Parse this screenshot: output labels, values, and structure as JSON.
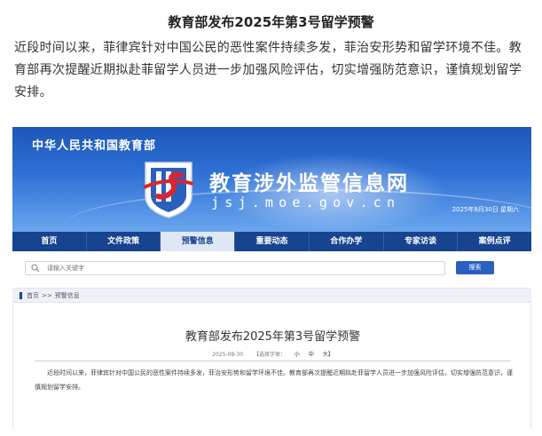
{
  "article": {
    "title": "教育部发布2025年第3号留学预警",
    "lead": "近段时间以来，菲律宾针对中国公民的恶性案件持续多发，菲治安形势和留学环境不佳。教育部再次提醒近期拟赴菲留学人员进一步加强风险评估，切实增强防范意识，谨慎规划留学安排。"
  },
  "site": {
    "ministry": "中华人民共和国教育部",
    "name": "教育涉外监管信息网",
    "domain": "jsj.moe.gov.cn",
    "date": "2025年8月30日 星期六"
  },
  "nav": {
    "items": [
      {
        "label": "首页"
      },
      {
        "label": "文件政策"
      },
      {
        "label": "预警信息"
      },
      {
        "label": "重要动态"
      },
      {
        "label": "合作办学"
      },
      {
        "label": "专家访谈"
      },
      {
        "label": "案例点评"
      }
    ],
    "active_index": 2
  },
  "search": {
    "placeholder": "请输入关键字",
    "button_label": "搜索"
  },
  "breadcrumb": {
    "home": "首页",
    "separator": ">>",
    "current": "预警信息"
  },
  "content": {
    "title": "教育部发布2025年第3号留学预警",
    "date": "2025-08-30",
    "font_size_label": "【选择字体：",
    "size_small": "小",
    "size_medium": "中",
    "size_large": "大】",
    "body": "近段时间以来，菲律宾针对中国公民的恶性案件持续多发，菲治安形势和留学环境不佳。教育部再次提醒近期拟赴菲留学人员进一步加强风险评估，切实增强防范意识，谨慎规划留学安排。"
  },
  "colors": {
    "banner_top": "#1d56b8",
    "nav_bg": "#17438f",
    "button_bg": "#2a5fc0",
    "emblem_red": "#d9262e"
  },
  "icons": {
    "emblem": "jsj-logo-emblem",
    "search": "search-icon"
  }
}
